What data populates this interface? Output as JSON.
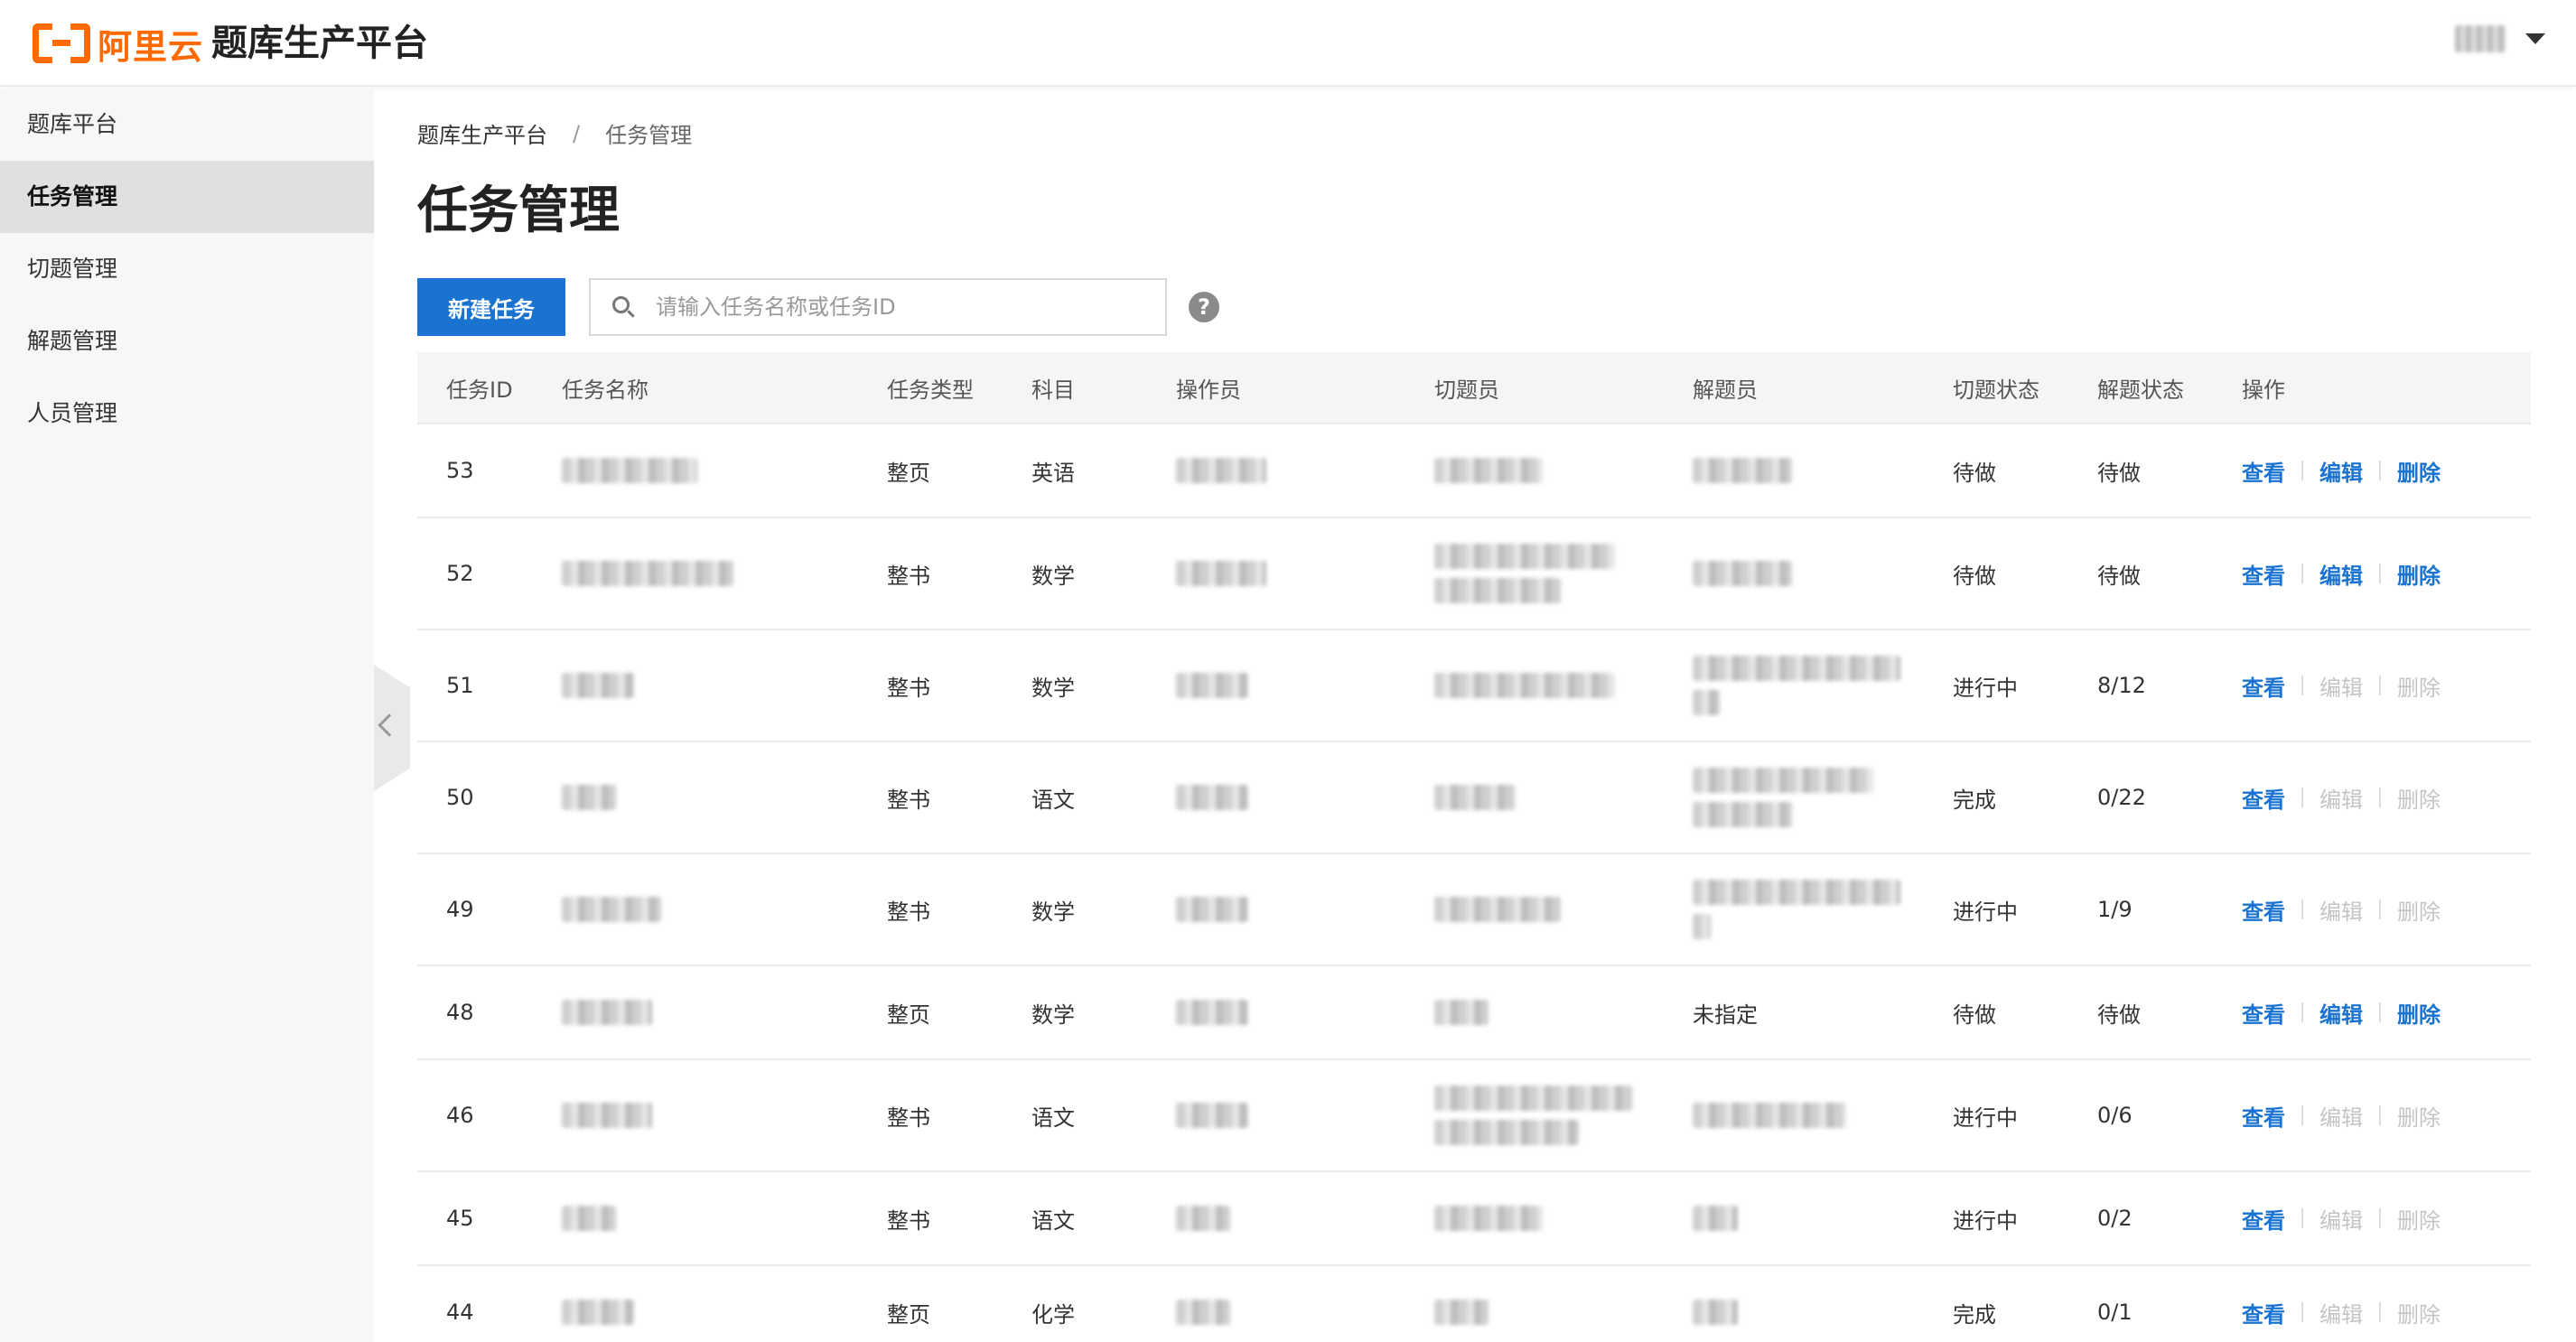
{
  "header": {
    "logo_text": "阿里云",
    "app_title": "题库生产平台"
  },
  "sidebar": {
    "items": [
      {
        "label": "题库平台",
        "active": false
      },
      {
        "label": "任务管理",
        "active": true
      },
      {
        "label": "切题管理",
        "active": false
      },
      {
        "label": "解题管理",
        "active": false
      },
      {
        "label": "人员管理",
        "active": false
      }
    ]
  },
  "breadcrumb": {
    "root": "题库生产平台",
    "separator": "/",
    "current": "任务管理"
  },
  "page_title": "任务管理",
  "toolbar": {
    "new_task_label": "新建任务",
    "search_placeholder": "请输入任务名称或任务ID",
    "help_glyph": "?"
  },
  "table": {
    "columns": [
      "任务ID",
      "任务名称",
      "任务类型",
      "科目",
      "操作员",
      "切题员",
      "解题员",
      "切题状态",
      "解题状态",
      "操作"
    ],
    "actions": {
      "view": "查看",
      "edit": "编辑",
      "delete": "删除"
    },
    "rows": [
      {
        "id": "53",
        "type": "整页",
        "subject": "英语",
        "solver": "",
        "cut_status": "待做",
        "solve_status": "待做",
        "editable": true
      },
      {
        "id": "52",
        "type": "整书",
        "subject": "数学",
        "solver": "",
        "cut_status": "待做",
        "solve_status": "待做",
        "editable": true
      },
      {
        "id": "51",
        "type": "整书",
        "subject": "数学",
        "solver": "",
        "cut_status": "进行中",
        "solve_status": "8/12",
        "editable": false
      },
      {
        "id": "50",
        "type": "整书",
        "subject": "语文",
        "solver": "",
        "cut_status": "完成",
        "solve_status": "0/22",
        "editable": false
      },
      {
        "id": "49",
        "type": "整书",
        "subject": "数学",
        "solver": "",
        "cut_status": "进行中",
        "solve_status": "1/9",
        "editable": false
      },
      {
        "id": "48",
        "type": "整页",
        "subject": "数学",
        "solver": "未指定",
        "cut_status": "待做",
        "solve_status": "待做",
        "editable": true
      },
      {
        "id": "46",
        "type": "整书",
        "subject": "语文",
        "solver": "",
        "cut_status": "进行中",
        "solve_status": "0/6",
        "editable": false
      },
      {
        "id": "45",
        "type": "整书",
        "subject": "语文",
        "solver": "",
        "cut_status": "进行中",
        "solve_status": "0/2",
        "editable": false
      },
      {
        "id": "44",
        "type": "整页",
        "subject": "化学",
        "solver": "",
        "cut_status": "完成",
        "solve_status": "0/1",
        "editable": false
      }
    ]
  },
  "colors": {
    "brand_orange": "#ff6a00",
    "primary_blue": "#1a73d0",
    "disabled_gray": "#c4c4c4"
  }
}
